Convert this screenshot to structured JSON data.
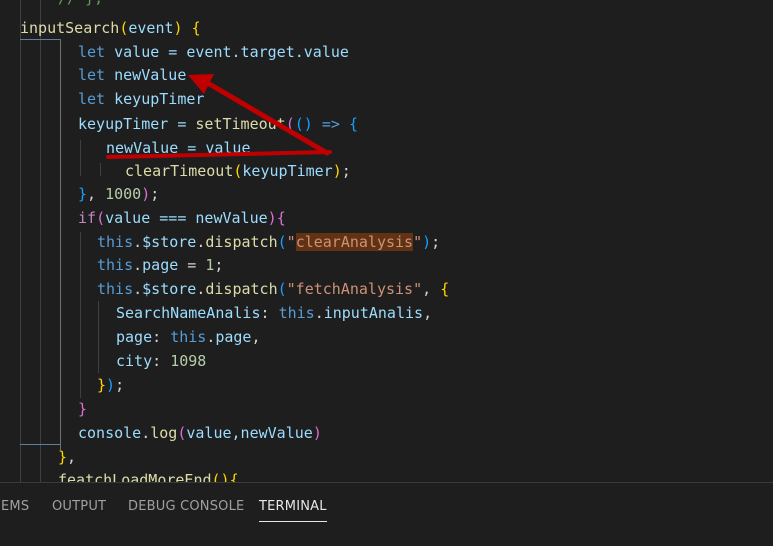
{
  "editor": {
    "lines": {
      "l0": {
        "text": "// },",
        "tokens": [
          {
            "t": "// },",
            "c": "cmt"
          }
        ]
      },
      "l1": {
        "tokens": [
          {
            "t": "inputSearch",
            "c": "fn"
          },
          {
            "t": "(",
            "c": "br1"
          },
          {
            "t": "event",
            "c": "var"
          },
          {
            "t": ")",
            "c": "br1"
          },
          {
            "t": " ",
            "c": "pun"
          },
          {
            "t": "{",
            "c": "br1"
          }
        ]
      },
      "l2": {
        "tokens": [
          {
            "t": "let",
            "c": "kw"
          },
          {
            "t": " value = ",
            "c": "var"
          },
          {
            "t": "event.target.value",
            "c": "var"
          }
        ]
      },
      "l3": {
        "tokens": [
          {
            "t": "let",
            "c": "kw"
          },
          {
            "t": " newValue",
            "c": "var"
          }
        ]
      },
      "l4": {
        "tokens": [
          {
            "t": "let",
            "c": "kw"
          },
          {
            "t": " keyupTimer",
            "c": "var"
          }
        ]
      },
      "l5": {
        "tokens": [
          {
            "t": "keyupTimer = ",
            "c": "var"
          },
          {
            "t": "setTimeout",
            "c": "fn"
          },
          {
            "t": "(",
            "c": "br2"
          },
          {
            "t": "()",
            "c": "br3"
          },
          {
            "t": " ",
            "c": "pun"
          },
          {
            "t": "=>",
            "c": "kw"
          },
          {
            "t": " ",
            "c": "pun"
          },
          {
            "t": "{",
            "c": "br3"
          }
        ]
      },
      "l6": {
        "tokens": [
          {
            "t": "newValue = value",
            "c": "var"
          }
        ]
      },
      "l7": {
        "tokens": [
          {
            "t": "clearTimeout",
            "c": "fn"
          },
          {
            "t": "(",
            "c": "br1"
          },
          {
            "t": "keyupTimer",
            "c": "var"
          },
          {
            "t": ")",
            "c": "br1"
          },
          {
            "t": ";",
            "c": "pun"
          }
        ]
      },
      "l8": {
        "tokens": [
          {
            "t": "}",
            "c": "br3"
          },
          {
            "t": ", ",
            "c": "pun"
          },
          {
            "t": "1000",
            "c": "num"
          },
          {
            "t": ")",
            "c": "br2"
          },
          {
            "t": ";",
            "c": "pun"
          }
        ]
      },
      "l9": {
        "tokens": [
          {
            "t": "if",
            "c": "ctl"
          },
          {
            "t": "(",
            "c": "br2"
          },
          {
            "t": "value === newValue",
            "c": "var"
          },
          {
            "t": ")",
            "c": "br2"
          },
          {
            "t": "{",
            "c": "br2"
          }
        ]
      },
      "l10": {
        "tokens": [
          {
            "t": "this",
            "c": "kw"
          },
          {
            "t": ".",
            "c": "pun"
          },
          {
            "t": "$store",
            "c": "var"
          },
          {
            "t": ".",
            "c": "pun"
          },
          {
            "t": "dispatch",
            "c": "fn"
          },
          {
            "t": "(",
            "c": "br3"
          },
          {
            "t": "\"",
            "c": "str"
          },
          {
            "t": "clearAnalysis",
            "c": "str hl"
          },
          {
            "t": "\"",
            "c": "str"
          },
          {
            "t": ")",
            "c": "br3"
          },
          {
            "t": ";",
            "c": "pun"
          }
        ]
      },
      "l11": {
        "tokens": [
          {
            "t": "this",
            "c": "kw"
          },
          {
            "t": ".",
            "c": "pun"
          },
          {
            "t": "page",
            "c": "var"
          },
          {
            "t": " = ",
            "c": "pun"
          },
          {
            "t": "1",
            "c": "num"
          },
          {
            "t": ";",
            "c": "pun"
          }
        ]
      },
      "l12": {
        "tokens": [
          {
            "t": "this",
            "c": "kw"
          },
          {
            "t": ".",
            "c": "pun"
          },
          {
            "t": "$store",
            "c": "var"
          },
          {
            "t": ".",
            "c": "pun"
          },
          {
            "t": "dispatch",
            "c": "fn"
          },
          {
            "t": "(",
            "c": "br3"
          },
          {
            "t": "\"fetchAnalysis\"",
            "c": "str"
          },
          {
            "t": ", ",
            "c": "pun"
          },
          {
            "t": "{",
            "c": "br1"
          }
        ]
      },
      "l13": {
        "tokens": [
          {
            "t": "SearchNameAnalis",
            "c": "var"
          },
          {
            "t": ": ",
            "c": "pun"
          },
          {
            "t": "this",
            "c": "kw"
          },
          {
            "t": ".",
            "c": "pun"
          },
          {
            "t": "inputAnalis",
            "c": "var"
          },
          {
            "t": ",",
            "c": "pun"
          }
        ]
      },
      "l14": {
        "tokens": [
          {
            "t": "page",
            "c": "var"
          },
          {
            "t": ": ",
            "c": "pun"
          },
          {
            "t": "this",
            "c": "kw"
          },
          {
            "t": ".",
            "c": "pun"
          },
          {
            "t": "page",
            "c": "var"
          },
          {
            "t": ",",
            "c": "pun"
          }
        ]
      },
      "l15": {
        "tokens": [
          {
            "t": "city",
            "c": "var"
          },
          {
            "t": ": ",
            "c": "pun"
          },
          {
            "t": "1098",
            "c": "num"
          }
        ]
      },
      "l16": {
        "tokens": [
          {
            "t": "}",
            "c": "br1"
          },
          {
            "t": ")",
            "c": "br3"
          },
          {
            "t": ";",
            "c": "pun"
          }
        ]
      },
      "l17": {
        "tokens": [
          {
            "t": "}",
            "c": "br2"
          }
        ]
      },
      "l18": {
        "tokens": [
          {
            "t": "console",
            "c": "var"
          },
          {
            "t": ".",
            "c": "pun"
          },
          {
            "t": "log",
            "c": "fn"
          },
          {
            "t": "(",
            "c": "br2"
          },
          {
            "t": "value,newValue",
            "c": "var"
          },
          {
            "t": ")",
            "c": "br2"
          }
        ]
      },
      "l19": {
        "tokens": [
          {
            "t": "}",
            "c": "br1"
          },
          {
            "t": ",",
            "c": "pun"
          }
        ]
      },
      "l20": {
        "tokens": [
          {
            "t": "featchLoadMoreEnd",
            "c": "fn"
          },
          {
            "t": "()",
            "c": "br1"
          },
          {
            "t": "{",
            "c": "br1"
          }
        ]
      }
    }
  },
  "annotation": {
    "color": "#c00000"
  },
  "panel": {
    "tabs": {
      "problems": "EMS",
      "output": "OUTPUT",
      "debug_console": "DEBUG CONSOLE",
      "terminal": "TERMINAL"
    },
    "active_tab": "terminal"
  }
}
